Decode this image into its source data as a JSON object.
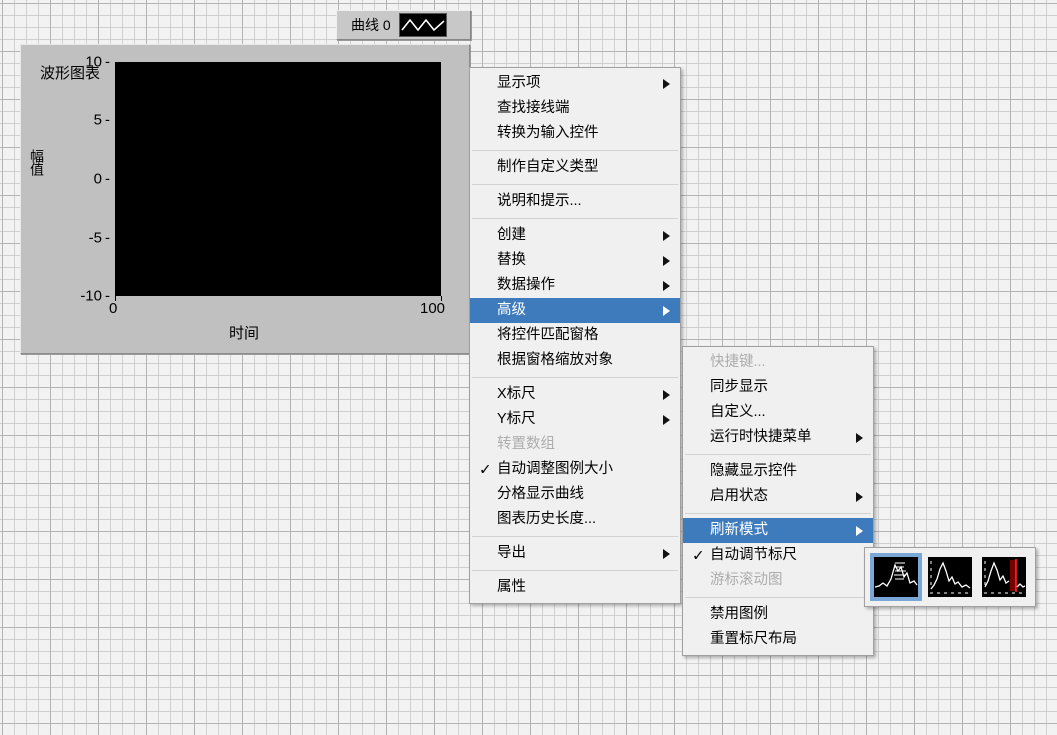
{
  "colors": {
    "panel_background": "#f2f2f2",
    "control_face": "#c0c0c0",
    "plot_background": "#000000",
    "menu_face": "#f0f0f0",
    "menu_highlight": "#3e7bbd",
    "menu_disabled_text": "#adadad",
    "tile_selection": "#7ba7d7",
    "cursor_red": "#cc0000"
  },
  "chart": {
    "title": "波形图表",
    "y_axis_title": "幅值",
    "x_axis_title": "时间",
    "y_ticks": [
      "10",
      "5",
      "0",
      "-5",
      "-10"
    ],
    "x_ticks": [
      "0",
      "100"
    ],
    "legend": {
      "plot_label": "曲线 0",
      "swatch_icon": "waveform-icon"
    }
  },
  "chart_data": {
    "type": "line",
    "title": "波形图表",
    "xlabel": "时间",
    "ylabel": "幅值",
    "xlim": [
      0,
      100
    ],
    "ylim": [
      -10,
      10
    ],
    "x_ticks": [
      0,
      100
    ],
    "y_ticks": [
      10,
      5,
      0,
      -5,
      -10
    ],
    "grid": false,
    "legend_position": "top-right",
    "series": [
      {
        "name": "曲线 0",
        "x": [],
        "values": []
      }
    ]
  },
  "context_menu_main": {
    "name": "shortcut-menu",
    "items": [
      {
        "label": "显示项",
        "submenu": true,
        "type": "item"
      },
      {
        "label": "查找接线端",
        "type": "item"
      },
      {
        "label": "转换为输入控件",
        "type": "item"
      },
      {
        "type": "separator"
      },
      {
        "label": "制作自定义类型",
        "type": "item"
      },
      {
        "type": "separator"
      },
      {
        "label": "说明和提示...",
        "type": "item"
      },
      {
        "type": "separator"
      },
      {
        "label": "创建",
        "submenu": true,
        "type": "item"
      },
      {
        "label": "替换",
        "submenu": true,
        "type": "item"
      },
      {
        "label": "数据操作",
        "submenu": true,
        "type": "item"
      },
      {
        "label": "高级",
        "submenu": true,
        "selected": true,
        "type": "item"
      },
      {
        "label": "将控件匹配窗格",
        "type": "item"
      },
      {
        "label": "根据窗格缩放对象",
        "type": "item"
      },
      {
        "type": "separator"
      },
      {
        "label": "X标尺",
        "submenu": true,
        "type": "item"
      },
      {
        "label": "Y标尺",
        "submenu": true,
        "type": "item"
      },
      {
        "label": "转置数组",
        "disabled": true,
        "type": "item"
      },
      {
        "label": "自动调整图例大小",
        "checked": true,
        "type": "item"
      },
      {
        "label": "分格显示曲线",
        "type": "item"
      },
      {
        "label": "图表历史长度...",
        "type": "item"
      },
      {
        "type": "separator"
      },
      {
        "label": "导出",
        "submenu": true,
        "type": "item"
      },
      {
        "type": "separator"
      },
      {
        "label": "属性",
        "type": "item"
      }
    ]
  },
  "context_menu_advanced": {
    "name": "advanced-submenu",
    "items": [
      {
        "label": "快捷键...",
        "disabled": true,
        "type": "item"
      },
      {
        "label": "同步显示",
        "type": "item"
      },
      {
        "label": "自定义...",
        "type": "item"
      },
      {
        "label": "运行时快捷菜单",
        "submenu": true,
        "type": "item"
      },
      {
        "type": "separator"
      },
      {
        "label": "隐藏显示控件",
        "type": "item"
      },
      {
        "label": "启用状态",
        "submenu": true,
        "type": "item"
      },
      {
        "type": "separator"
      },
      {
        "label": "刷新模式",
        "submenu": true,
        "selected": true,
        "type": "item"
      },
      {
        "label": "自动调节标尺",
        "checked": true,
        "type": "item"
      },
      {
        "label": "游标滚动图",
        "disabled": true,
        "type": "item"
      },
      {
        "type": "separator"
      },
      {
        "label": "禁用图例",
        "type": "item"
      },
      {
        "label": "重置标尺布局",
        "type": "item"
      }
    ]
  },
  "context_menu_refresh_mode": {
    "name": "refresh-mode-submenu",
    "tiles": [
      {
        "icon": "strip-chart-icon",
        "active": true
      },
      {
        "icon": "scope-chart-icon",
        "active": false
      },
      {
        "icon": "sweep-chart-icon",
        "active": false
      }
    ]
  }
}
